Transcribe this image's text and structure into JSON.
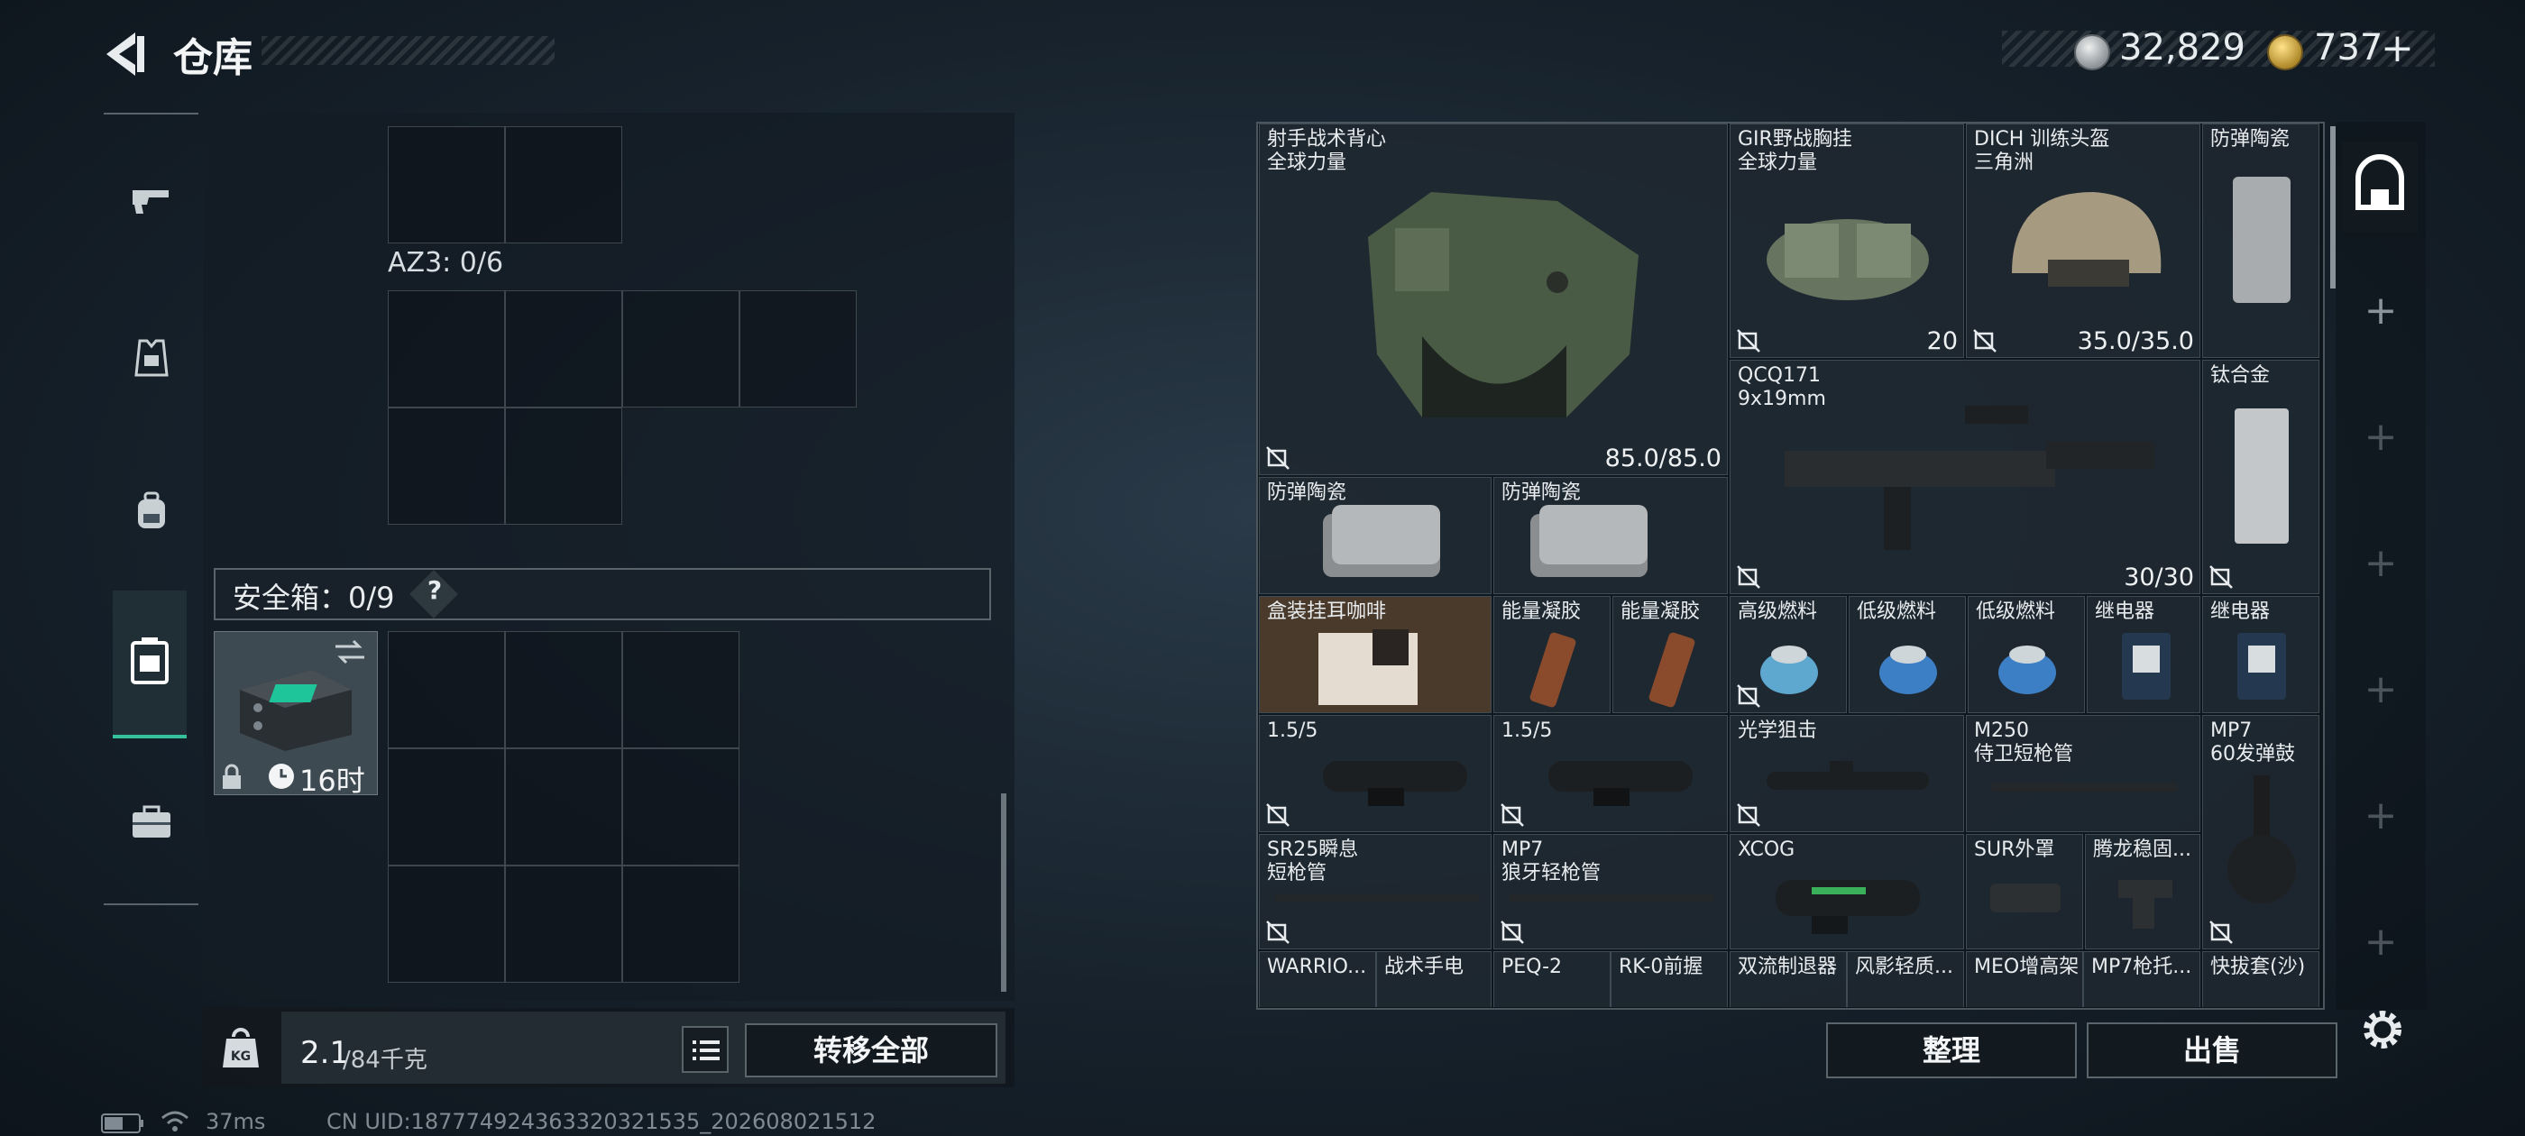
{
  "header": {
    "title": "仓库",
    "back_icon": "back-arrow-icon",
    "currencies": [
      {
        "icon": "silver-coin-icon",
        "amount": "32,829",
        "color": "#b9bec2"
      },
      {
        "icon": "gold-coin-icon",
        "amount": "737",
        "plus": "+",
        "color": "#d4a63a"
      }
    ]
  },
  "sidebar": {
    "items": [
      {
        "name": "weapons",
        "icon": "pistol-icon"
      },
      {
        "name": "vest",
        "icon": "vest-icon"
      },
      {
        "name": "backpack",
        "icon": "backpack-icon"
      },
      {
        "name": "safebox",
        "icon": "safebox-icon",
        "selected": true
      },
      {
        "name": "case",
        "icon": "case-icon"
      }
    ],
    "accent_color": "#35c29a"
  },
  "containers": {
    "az3_label": "AZ3: 0/6",
    "safebox_label": "安全箱：0/9",
    "safebox_help": "?",
    "safebox_item": {
      "timer": "16时",
      "icons": [
        "lock-icon",
        "clock-icon",
        "swap-icon"
      ]
    }
  },
  "weight": {
    "current": "2.1",
    "unit": "/84千克",
    "icon": "kg-weight-icon"
  },
  "buttons": {
    "transfer_all": "转移全部",
    "sort": "整理",
    "sell": "出售",
    "list_icon": "list-icon",
    "settings_icon": "gear-icon"
  },
  "stash": {
    "items": [
      {
        "name": "射手战术背心\n全球力量",
        "value": "85.0/85.0",
        "badge": true
      },
      {
        "name": "GIR野战胸挂\n全球力量",
        "value": "20",
        "badge": true
      },
      {
        "name": "DICH 训练头盔\n三角洲",
        "value": "35.0/35.0",
        "badge": true
      },
      {
        "name": "防弹陶瓷",
        "value": "",
        "badge": false
      },
      {
        "name": "QCQ171\n9x19mm",
        "value": "30/30",
        "badge": true
      },
      {
        "name": "钛合金",
        "value": "",
        "badge": true
      },
      {
        "name": "防弹陶瓷",
        "value": "",
        "badge": false
      },
      {
        "name": "防弹陶瓷",
        "value": "",
        "badge": false
      },
      {
        "name": "盒装挂耳咖啡",
        "value": "",
        "badge": false
      },
      {
        "name": "能量凝胶",
        "value": "",
        "badge": false
      },
      {
        "name": "能量凝胶",
        "value": "",
        "badge": false
      },
      {
        "name": "高级燃料",
        "value": "",
        "badge": true
      },
      {
        "name": "低级燃料",
        "value": "",
        "badge": false
      },
      {
        "name": "低级燃料",
        "value": "",
        "badge": false
      },
      {
        "name": "继电器",
        "value": "",
        "badge": false
      },
      {
        "name": "继电器",
        "value": "",
        "badge": false
      },
      {
        "name": "1.5/5",
        "value": "",
        "badge": true
      },
      {
        "name": "1.5/5",
        "value": "",
        "badge": true
      },
      {
        "name": "光学狙击",
        "value": "",
        "badge": true
      },
      {
        "name": "M250\n侍卫短枪管",
        "value": "",
        "badge": false
      },
      {
        "name": "MP7\n60发弹鼓",
        "value": "",
        "badge": true
      },
      {
        "name": "SR25瞬息\n短枪管",
        "value": "",
        "badge": true
      },
      {
        "name": "MP7\n狼牙轻枪管",
        "value": "",
        "badge": true
      },
      {
        "name": "XCOG",
        "value": "",
        "badge": false
      },
      {
        "name": "SUR外罩",
        "value": "",
        "badge": false
      },
      {
        "name": "腾龙稳固...",
        "value": "",
        "badge": false
      },
      {
        "name": "WARRIO...",
        "value": "",
        "badge": false
      },
      {
        "name": "战术手电",
        "value": "",
        "badge": false
      },
      {
        "name": "PEQ-2",
        "value": "",
        "badge": false
      },
      {
        "name": "RK-0前握",
        "value": "",
        "badge": false
      },
      {
        "name": "双流制退器",
        "value": "",
        "badge": false
      },
      {
        "name": "风影轻质...",
        "value": "",
        "badge": false
      },
      {
        "name": "MEO增高架",
        "value": "",
        "badge": false
      },
      {
        "name": "MP7枪托...",
        "value": "",
        "badge": false
      },
      {
        "name": "快拔套(沙)",
        "value": "",
        "badge": false
      }
    ],
    "badge_icon": "no-insure-icon",
    "cell_highlight_color": "#4a3a2c"
  },
  "rail": {
    "select_icon": "stash-page-icon",
    "plus": "+"
  },
  "status": {
    "ping": "37ms",
    "uid": "CN UID:18777492436332032​1535_202608021512",
    "battery_icon": "battery-icon",
    "wifi_icon": "wifi-icon"
  }
}
